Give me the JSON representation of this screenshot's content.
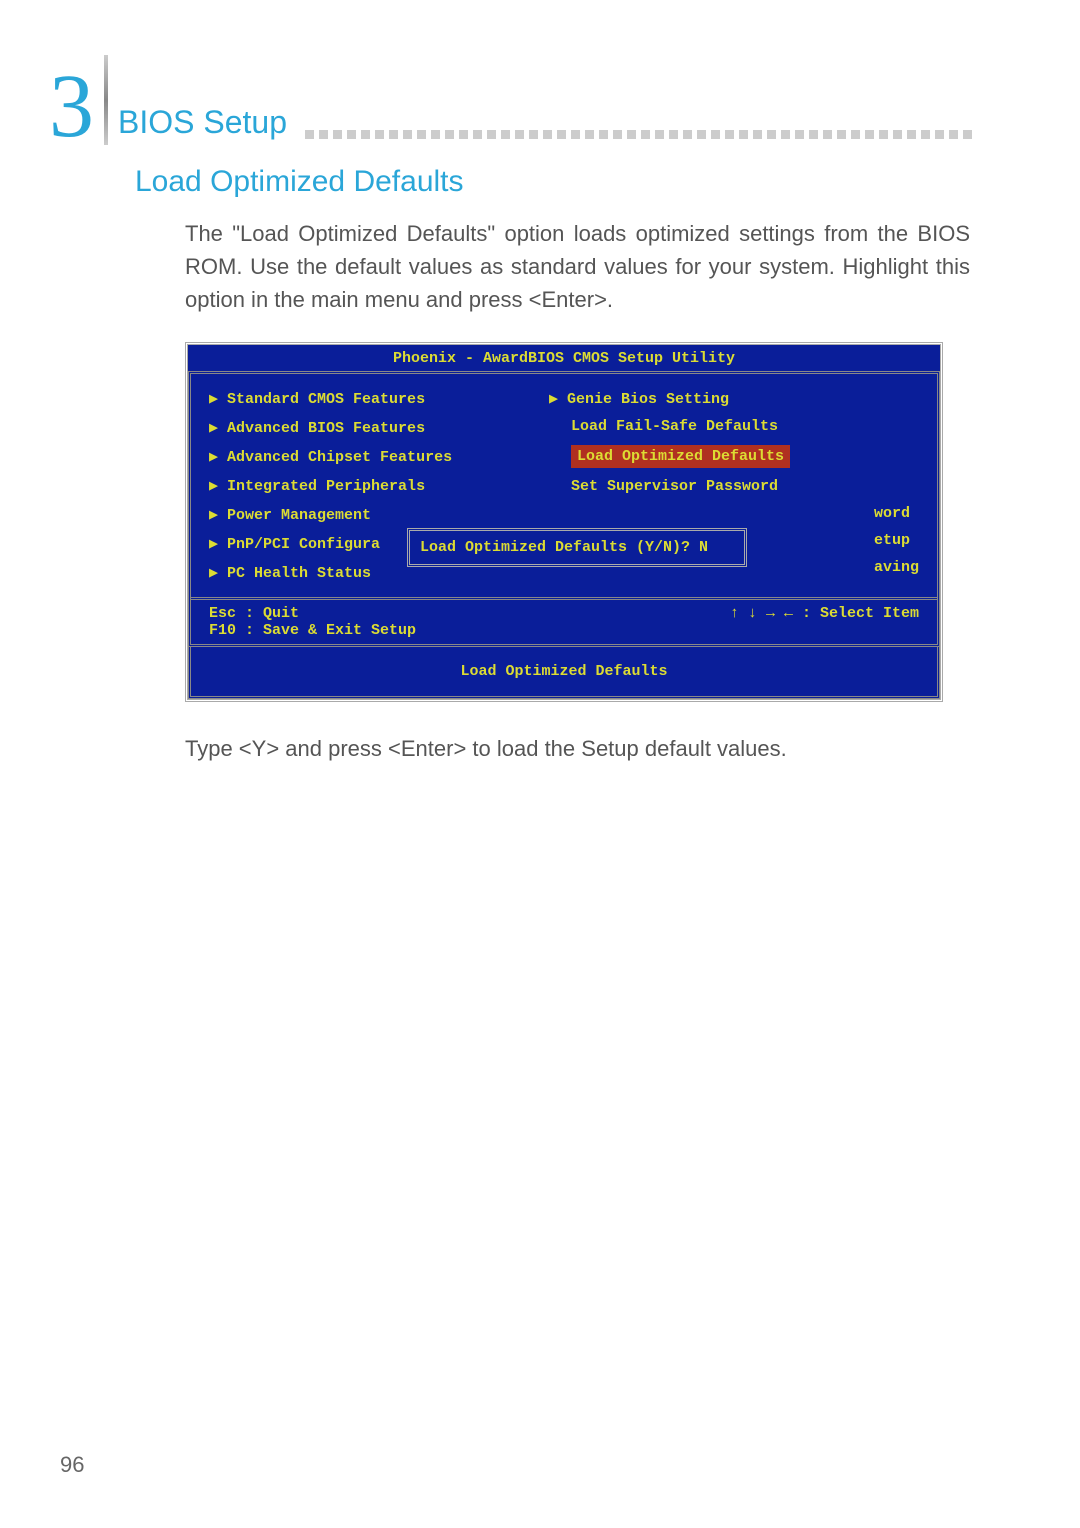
{
  "chapter": {
    "number": "3",
    "title": "BIOS Setup"
  },
  "section": {
    "heading": "Load Optimized Defaults"
  },
  "intro_text": "The \"Load Optimized Defaults\" option loads optimized settings from the BIOS ROM. Use the default values as standard values for your system. Highlight this option in the main menu and press <Enter>.",
  "bios": {
    "title": "Phoenix - AwardBIOS CMOS Setup Utility",
    "left_items": [
      "▶ Standard CMOS Features",
      "▶ Advanced BIOS Features",
      "▶ Advanced Chipset Features",
      "▶ Integrated Peripherals",
      "▶ Power Management",
      "▶ PnP/PCI Configura",
      "▶ PC Health Status"
    ],
    "right_items": [
      "▶ Genie Bios Setting",
      "Load Fail-Safe Defaults",
      "Load Optimized Defaults",
      "Set Supervisor Password",
      "word",
      "etup",
      "aving"
    ],
    "dialog_text": "Load Optimized Defaults (Y/N)? N",
    "footer_left": "Esc : Quit\nF10 : Save & Exit Setup",
    "footer_right": "↑ ↓ → ←   : Select Item",
    "footer_bar": "Load Optimized Defaults"
  },
  "closing_text": "Type <Y> and press <Enter> to load the Setup default values.",
  "page_number": "96"
}
